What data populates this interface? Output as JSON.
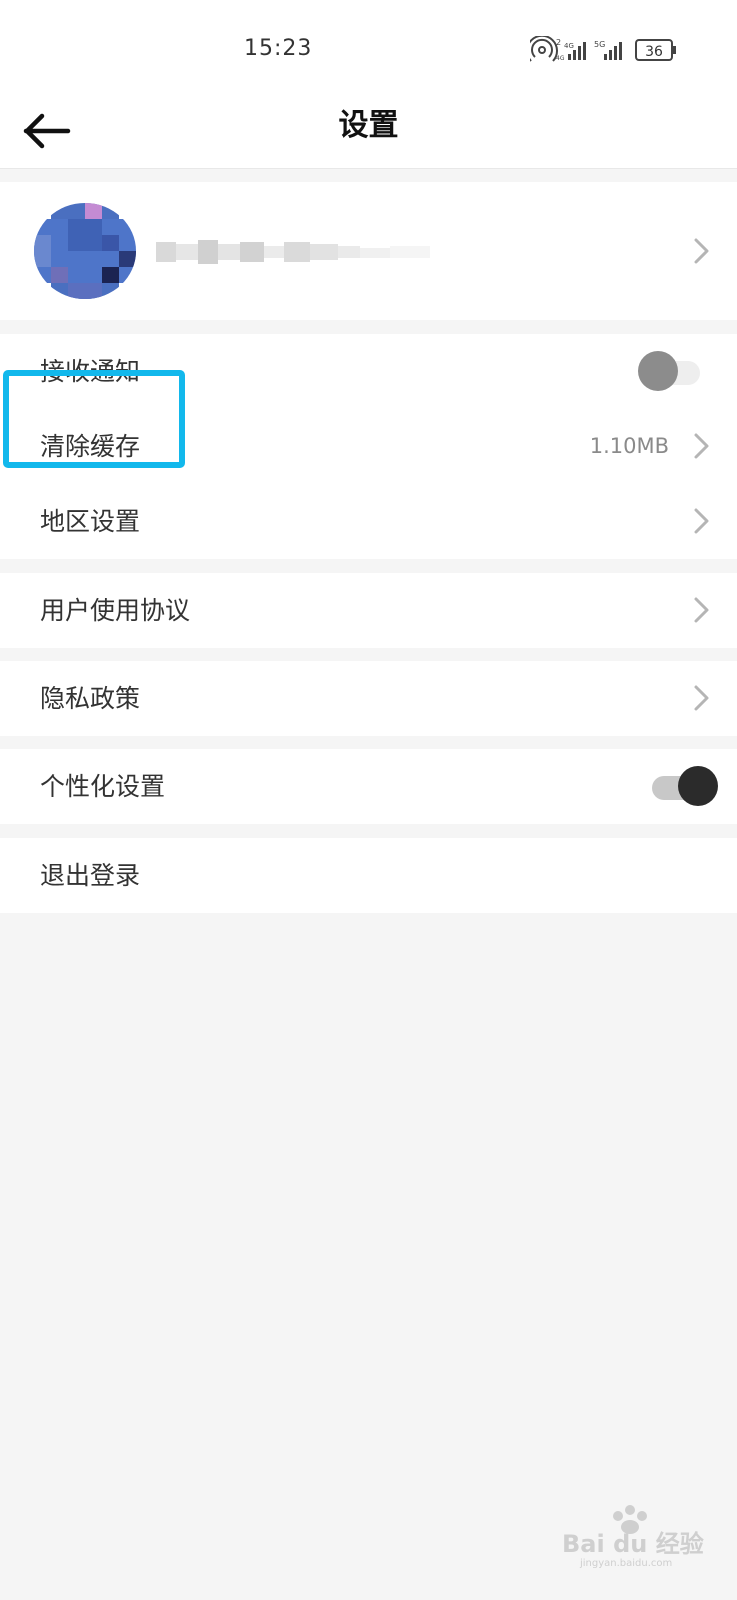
{
  "status_bar": {
    "time": "15:23",
    "sim1_labels": [
      "2",
      "4G",
      "4G"
    ],
    "sim2_label": "5G",
    "battery_level": "36"
  },
  "header": {
    "title": "设置",
    "back_icon": "arrow-left-icon"
  },
  "profile": {
    "avatar_icon": "pixelated-avatar",
    "username_hidden": true,
    "chevron_icon": "chevron-right-icon"
  },
  "settings": {
    "receive_notifications": {
      "label": "接收通知",
      "enabled": false
    },
    "clear_cache": {
      "label": "清除缓存",
      "value": "1.10MB"
    },
    "region_settings": {
      "label": "地区设置"
    },
    "user_agreement": {
      "label": "用户使用协议"
    },
    "privacy_policy": {
      "label": "隐私政策"
    },
    "personalization": {
      "label": "个性化设置",
      "enabled": true
    },
    "logout": {
      "label": "退出登录"
    }
  },
  "annotation": {
    "highlight_color": "#12b8ec"
  },
  "watermark": {
    "brand": "Bai du 经验",
    "url": "jingyan.baidu.com"
  },
  "colors": {
    "background": "#f5f5f5",
    "card": "#ffffff",
    "text": "#333333",
    "secondary_text": "#8a8a8a",
    "chevron": "#b5b5b5",
    "toggle_off_knob": "#8c8c8c",
    "toggle_on_knob": "#2b2b2b"
  }
}
